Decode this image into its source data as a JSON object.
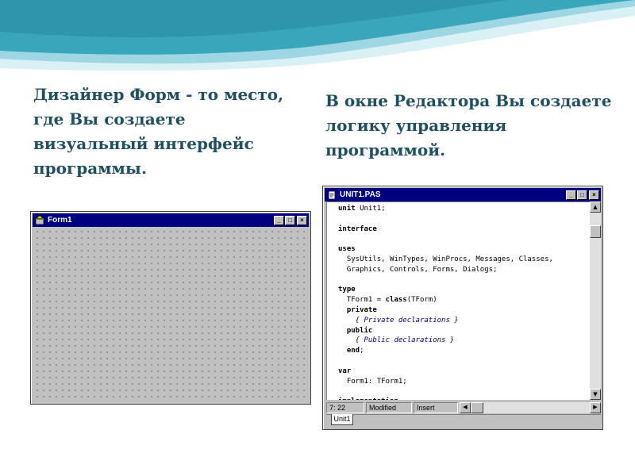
{
  "slide": {
    "left_text": "Дизайнер Форм - то место, где Вы создаете визуальный интерфейс программы.",
    "right_text": "В окне Редактора Вы создаете логику управления программой."
  },
  "form_window": {
    "title": "Form1",
    "icon": "delphi-form-icon",
    "buttons": [
      "_",
      "□",
      "×"
    ]
  },
  "editor_window": {
    "title": "UNIT1.PAS",
    "icon": "unit-file-icon",
    "buttons": [
      "_",
      "□",
      "×"
    ],
    "code_lines": [
      {
        "kw": "unit",
        "rest": " Unit1;"
      },
      {
        "kw": "",
        "rest": ""
      },
      {
        "kw": "interface",
        "rest": ""
      },
      {
        "kw": "",
        "rest": ""
      },
      {
        "kw": "uses",
        "rest": ""
      },
      {
        "kw": "",
        "rest": "  SysUtils, WinTypes, WinProcs, Messages, Classes,"
      },
      {
        "kw": "",
        "rest": "  Graphics, Controls, Forms, Dialogs;"
      },
      {
        "kw": "",
        "rest": ""
      },
      {
        "kw": "type",
        "rest": ""
      },
      {
        "kw": "",
        "rest": "  TForm1 = ",
        "kw2": "class",
        "rest2": "(TForm)"
      },
      {
        "kw": "  private",
        "rest": ""
      },
      {
        "kw": "",
        "rest": "",
        "comment": "    { Private declarations }"
      },
      {
        "kw": "  public",
        "rest": ""
      },
      {
        "kw": "",
        "rest": "",
        "comment": "    { Public declarations }"
      },
      {
        "kw": "  end",
        "rest": ";"
      },
      {
        "kw": "",
        "rest": ""
      },
      {
        "kw": "var",
        "rest": ""
      },
      {
        "kw": "",
        "rest": "  Form1: TForm1;"
      },
      {
        "kw": "",
        "rest": ""
      },
      {
        "kw": "implementation",
        "rest": ""
      }
    ],
    "status": {
      "position": "7:  22",
      "state": "Modified",
      "mode": "Insert"
    },
    "tab_label": "Unit1"
  },
  "colors": {
    "title_bar": "#000080",
    "window_face": "#c0c0c0",
    "slide_text": "#1f4f63",
    "wave_dark": "#2f9fb5",
    "wave_light": "#bfe6ee"
  }
}
